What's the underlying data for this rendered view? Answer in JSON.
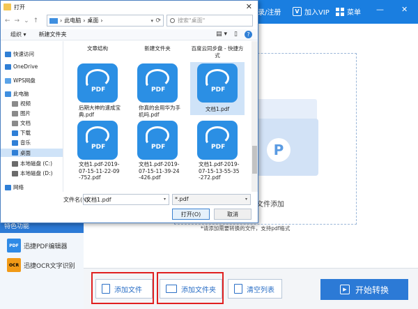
{
  "app": {
    "login_label": "录/注册",
    "vip_label": "加入VIP",
    "menu_label": "菜单",
    "features_title": "特色功能",
    "features": [
      {
        "icon_text": "PDF",
        "label": "迅捷PDF编辑器"
      },
      {
        "icon_text": "OCR",
        "label": "迅捷OCR文字识别"
      }
    ],
    "drop_label": "文件添加",
    "hint": "*请添加需要转换的文件，支持pdf格式",
    "buttons": {
      "add_file": "添加文件",
      "add_folder": "添加文件夹",
      "clear_list": "清空列表",
      "start": "开始转换"
    }
  },
  "dialog": {
    "title": "打开",
    "breadcrumb": [
      "此电脑",
      "桌面"
    ],
    "search_placeholder": "搜索\"桌面\"",
    "toolbar": {
      "organize": "组织 ▾",
      "new_folder": "新建文件夹"
    },
    "nav_items": [
      {
        "label": "快速访问",
        "icon": "star-icon",
        "color": "#2f7fd6"
      },
      {
        "label": "OneDrive",
        "icon": "cloud-icon",
        "color": "#2f7fd6"
      },
      {
        "label": "WPS网盘",
        "icon": "cloud-icon",
        "color": "#5aa3e8"
      },
      {
        "label": "此电脑",
        "icon": "computer-icon",
        "color": "#3f8fe0"
      },
      {
        "label": "视频",
        "icon": "video-icon",
        "color": "#8a8a8a"
      },
      {
        "label": "图片",
        "icon": "picture-icon",
        "color": "#8a8a8a"
      },
      {
        "label": "文档",
        "icon": "document-icon",
        "color": "#8a8a8a"
      },
      {
        "label": "下载",
        "icon": "download-icon",
        "color": "#2f7fd6"
      },
      {
        "label": "音乐",
        "icon": "music-icon",
        "color": "#2f7fd6"
      },
      {
        "label": "桌面",
        "icon": "desktop-icon",
        "color": "#2f7fd6",
        "selected": true
      },
      {
        "label": "本地磁盘 (C:)",
        "icon": "disk-icon",
        "color": "#6b6b6b"
      },
      {
        "label": "本地磁盘 (D:)",
        "icon": "disk-icon",
        "color": "#6b6b6b"
      },
      {
        "label": "网络",
        "icon": "network-icon",
        "color": "#2f7fd6"
      }
    ],
    "top_row": [
      "文章结构",
      "新建文件夹",
      "百度云同步盘 - 快捷方式"
    ],
    "pdf_files": [
      "后期大神的速成宝典.pdf",
      "你真的会用华为手机吗.pdf",
      "文档1.pdf",
      "文档1.pdf-2019-07-15-11-22-09-752.pdf",
      "文档1.pdf-2019-07-15-11-39-24-426.pdf",
      "文档1.pdf-2019-07-15-13-55-35-272.pdf"
    ],
    "selected_file": "文档1.pdf",
    "filename_label": "文件名(N):",
    "filename_value": "文档1.pdf",
    "filetype_value": "*.pdf",
    "open_button": "打开(O)",
    "cancel_button": "取消"
  }
}
